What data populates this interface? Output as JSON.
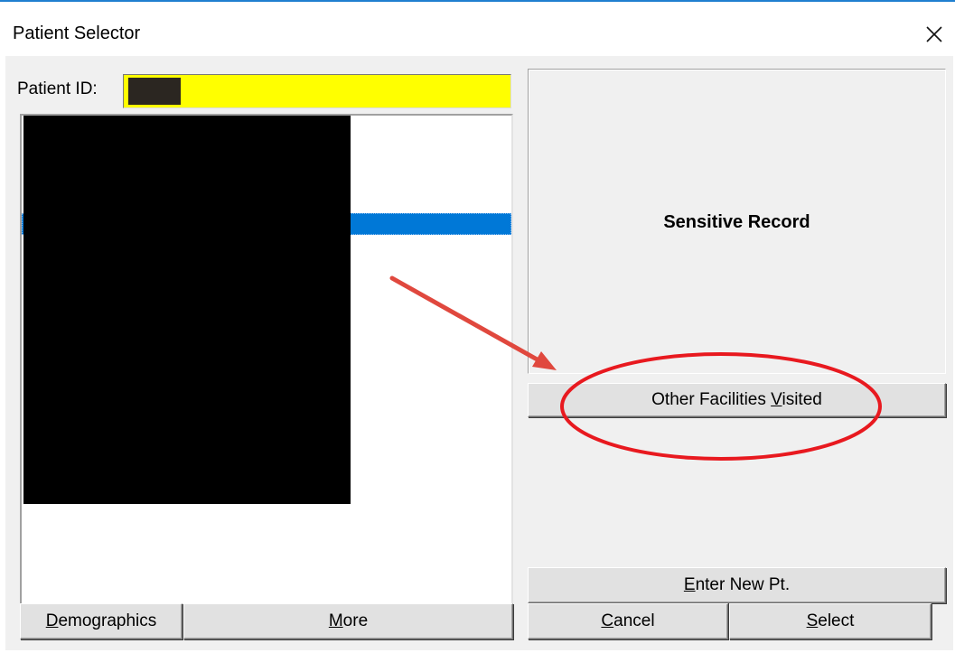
{
  "window": {
    "title": "Patient Selector",
    "close_glyph": "✕"
  },
  "patient_id": {
    "label": "Patient ID:",
    "value": "",
    "field_color": "#ffff00"
  },
  "panel": {
    "sensitive_text": "Sensitive Record"
  },
  "buttons": {
    "other_facilities": {
      "pre": "Other Facilities ",
      "accel": "V",
      "post": "isited"
    },
    "enter_new_pt": {
      "pre": "",
      "accel": "E",
      "post": "nter New Pt."
    },
    "cancel": {
      "pre": "",
      "accel": "C",
      "post": "ancel"
    },
    "select": {
      "pre": "",
      "accel": "S",
      "post": "elect"
    },
    "demographics": {
      "pre": "",
      "accel": "D",
      "post": "emographics"
    },
    "more": {
      "pre": "",
      "accel": "M",
      "post": "ore"
    }
  },
  "colors": {
    "selection": "#0078d7",
    "annotation": "#e8191f",
    "arrow": "#e0483e"
  }
}
